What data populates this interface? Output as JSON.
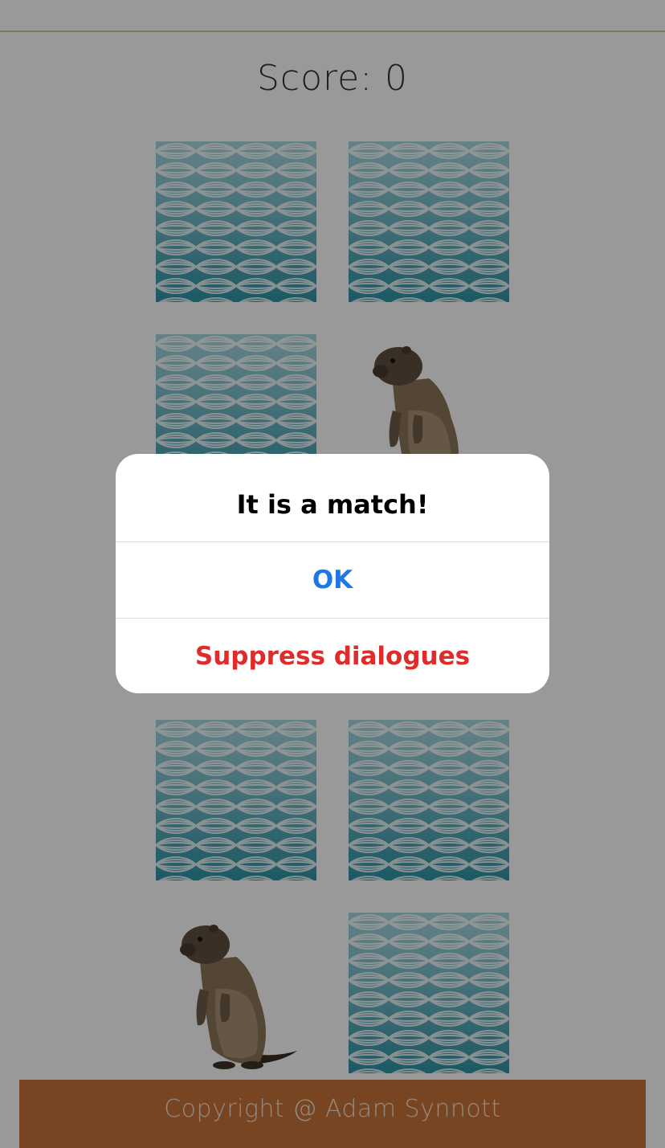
{
  "score": {
    "text": "Score: 0",
    "value": 0
  },
  "cards": [
    {
      "name": "card-1-1",
      "state": "face-down",
      "face": "wave-pattern"
    },
    {
      "name": "card-1-2",
      "state": "face-down",
      "face": "wave-pattern"
    },
    {
      "name": "card-2-1",
      "state": "face-down",
      "face": "wave-pattern"
    },
    {
      "name": "card-2-2",
      "state": "face-up",
      "face": "marmot"
    },
    {
      "name": "card-3-1",
      "state": "face-down",
      "face": "wave-pattern"
    },
    {
      "name": "card-3-2",
      "state": "face-down",
      "face": "wave-pattern"
    },
    {
      "name": "card-4-1",
      "state": "face-down",
      "face": "wave-pattern"
    },
    {
      "name": "card-4-2",
      "state": "face-down",
      "face": "wave-pattern"
    },
    {
      "name": "card-5-1",
      "state": "face-up",
      "face": "marmot"
    },
    {
      "name": "card-5-2",
      "state": "face-down",
      "face": "wave-pattern"
    }
  ],
  "footer": {
    "text": "Copyright @ Adam Synnott"
  },
  "dialog": {
    "title": "It is a match!",
    "ok_label": "OK",
    "suppress_label": "Suppress dialogues"
  },
  "colors": {
    "footer_bg": "#c8733a",
    "ok_blue": "#1f77e6",
    "suppress_red": "#e02b2b",
    "wave_teal": "#2f95a8"
  }
}
